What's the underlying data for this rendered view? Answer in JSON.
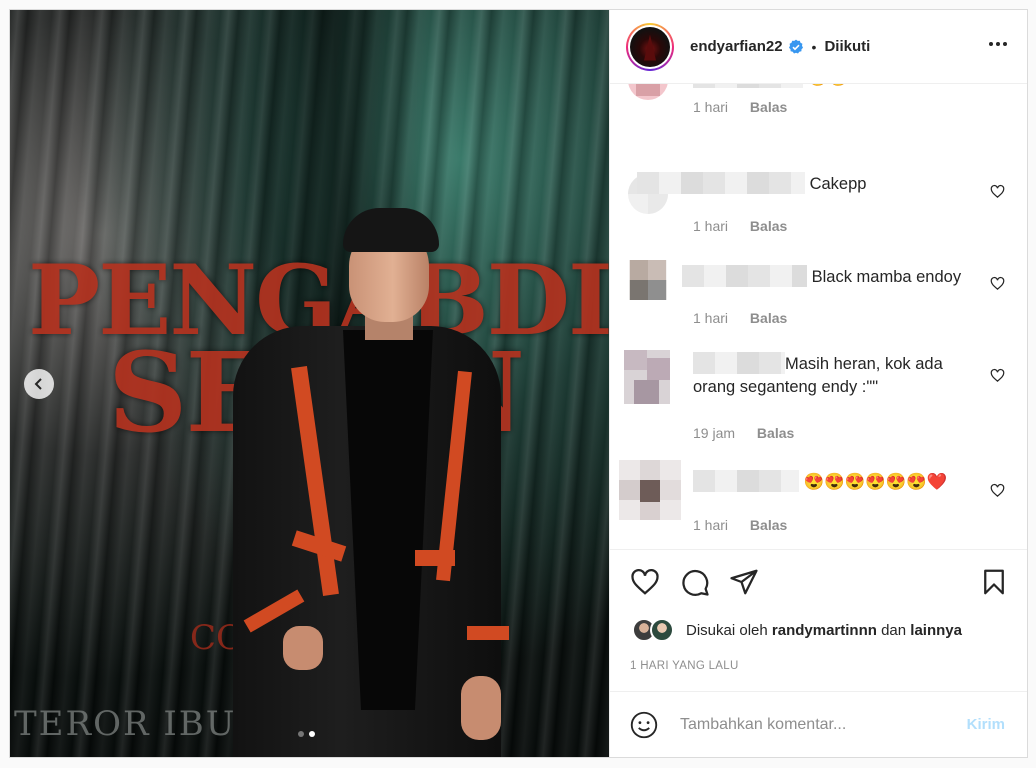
{
  "post": {
    "poster": {
      "title_line1": "PENGABDI",
      "title_line2": "SETAN",
      "subtitle": "CO",
      "tagline": "TEROR IBU SETAN MAS"
    },
    "carousel": {
      "current": 2,
      "total": 2
    },
    "header": {
      "username": "endyarfian22",
      "verified": true,
      "separator": "•",
      "follow_status": "Diikuti",
      "more_icon": "more-horizontal-icon"
    },
    "comments": [
      {
        "text": "",
        "time": "1 hari",
        "reply": "Balas"
      },
      {
        "text": "Cakepp",
        "time": "1 hari",
        "reply": "Balas"
      },
      {
        "text": "Black mamba endoy",
        "time": "1 hari",
        "reply": "Balas"
      },
      {
        "text": "Masih heran, kok ada orang seganteng endy :\"\"",
        "time": "19 jam",
        "reply": "Balas"
      },
      {
        "text": "😍😍😍😍😍😍❤️",
        "time": "1 hari",
        "reply": "Balas"
      }
    ],
    "actions": {
      "like_icon": "heart-icon",
      "comment_icon": "comment-icon",
      "share_icon": "send-icon",
      "save_icon": "bookmark-icon"
    },
    "likes": {
      "prefix": "Disukai oleh",
      "user": "randymartinnn",
      "conj": "dan",
      "others": "lainnya"
    },
    "timestamp": "1 HARI YANG LALU",
    "add_comment": {
      "placeholder": "Tambahkan komentar...",
      "send_label": "Kirim"
    },
    "colors": {
      "brand_red": "#d14a22",
      "verified_blue": "#3897f0",
      "send_disabled": "#b2dffc",
      "meta_gray": "#8e8e8e"
    }
  }
}
